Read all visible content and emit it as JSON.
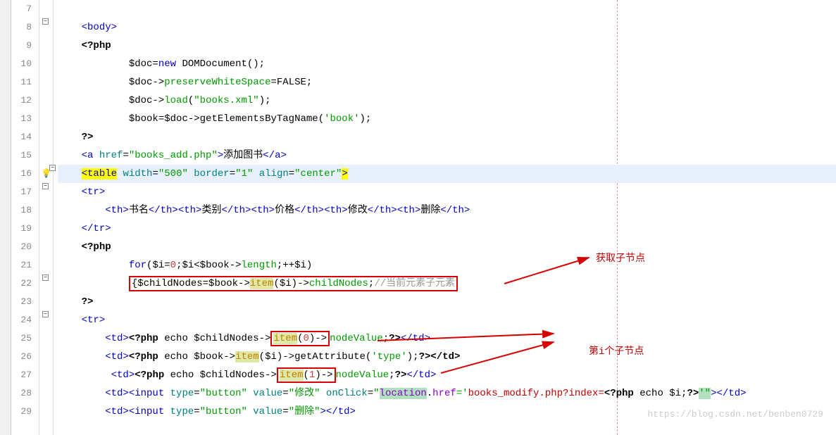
{
  "lines": {
    "start": 7,
    "nums": [
      "7",
      "8",
      "9",
      "10",
      "11",
      "12",
      "13",
      "14",
      "15",
      "16",
      "17",
      "18",
      "19",
      "20",
      "21",
      "22",
      "23",
      "24",
      "25",
      "26",
      "27",
      "28",
      "29"
    ]
  },
  "code": {
    "l8_body": "<body>",
    "l9_php": "<?php",
    "l10": "$doc=new DOMDocument();",
    "l10_new": "new",
    "l10_dd": "DOMDocument",
    "l11_a": "$doc->",
    "l11_b": "preserveWhiteSpace",
    "l11_c": "=FALSE;",
    "l12_a": "$doc->",
    "l12_b": "load",
    "l12_c": "(",
    "l12_d": "\"books.xml\"",
    "l12_e": ");",
    "l13_a": "$book=$doc->",
    "l13_b": "getElementsByTagName",
    "l13_c": "(",
    "l13_d": "'book'",
    "l13_e": ");",
    "l14": "?>",
    "l15_a": "<a",
    "l15_href": "href",
    "l15_val": "\"books_add.php\"",
    "l15_txt": "添加图书",
    "l15_close": "</a>",
    "l16_table": "<table",
    "l16_w": "width",
    "l16_wv": "\"500\"",
    "l16_b": "border",
    "l16_bv": "\"1\"",
    "l16_al": "align",
    "l16_av": "\"center\"",
    "l16_gt": ">",
    "l17_tr": "<tr>",
    "l18_th1": "书名",
    "l18_th2": "类别",
    "l18_th3": "价格",
    "l18_th4": "修改",
    "l18_th5": "删除",
    "l19_trc": "</tr>",
    "l20_php": "<?php",
    "l21_for": "for",
    "l21_a": "($i=",
    "l21_z": "0",
    "l21_b": ";$i<$book->",
    "l21_len": "length",
    "l21_c": ";++$i)",
    "l22_a": "{$childNodes=$book->",
    "l22_item": "item",
    "l22_b": "($i)->",
    "l22_cn": "childNodes",
    "l22_c": ";",
    "l22_comment": "//当前元素子元素",
    "l23": "?>",
    "l24_tr": "<tr>",
    "l25_a": "<td><?php",
    "l25_echo": " echo $childNodes->",
    "l25_item": "item",
    "l25_p": "(",
    "l25_n": "0",
    "l25_q": ")->",
    "l25_nv": "nodeValue",
    "l25_end": ";?></td>",
    "l26_a": "<td><?php",
    "l26_echo": " echo $book->",
    "l26_item": "item",
    "l26_p": "($i)->",
    "l26_ga": "getAttribute",
    "l26_q": "(",
    "l26_type": "'type'",
    "l26_r": ");",
    "l26_end": "?></td>",
    "l27_a": "<td><?php",
    "l27_echo": " echo $childNodes->",
    "l27_item": "item",
    "l27_p": "(",
    "l27_n": "1",
    "l27_q": ")->",
    "l27_nv": "nodeValue",
    "l27_end": ";?></td>",
    "l28_a": "<td><input ",
    "l28_type": "type",
    "l28_tv": "\"button\"",
    "l28_val": "value",
    "l28_vv": "\"修改\"",
    "l28_oc": "onClick",
    "l28_ov1": "\"",
    "l28_loc": "location",
    "l28_href": "href",
    "l28_ov2": "='",
    "l28_url": "books_modify.php?index=",
    "l28_php": "<?php",
    "l28_echo": " echo $i;",
    "l28_pend": "?>",
    "l28_ov3": "'\"",
    "l28_end": "></td>",
    "l29_a": "<td><input ",
    "l29_type": "type",
    "l29_tv": "\"button\"",
    "l29_val": "value",
    "l29_vv": "\"删除\"",
    "l29_end": "></td>"
  },
  "annotations": {
    "top": "获取子节点",
    "bottom": "第i个子节点"
  },
  "watermark": "https://blog.csdn.net/benben0729"
}
